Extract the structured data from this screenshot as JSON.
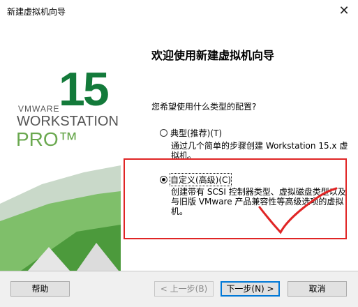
{
  "window": {
    "title": "新建虚拟机向导"
  },
  "branding": {
    "version": "15",
    "vmware": "VMWARE",
    "workstation": "WORKSTATION",
    "pro": "PRO™"
  },
  "content": {
    "heading": "欢迎使用新建虚拟机向导",
    "question": "您希望使用什么类型的配置?",
    "options": [
      {
        "label": "典型(推荐)(T)",
        "selected": false,
        "desc": "通过几个简单的步骤创建 Workstation 15.x 虚拟机。"
      },
      {
        "label": "自定义(高级)(C)",
        "selected": true,
        "desc": "创建带有 SCSI 控制器类型、虚拟磁盘类型以及与旧版 VMware 产品兼容性等高级选项的虚拟机。"
      }
    ]
  },
  "buttons": {
    "help": "帮助",
    "back": "< 上一步(B)",
    "next": "下一步(N) >",
    "cancel": "取消"
  },
  "colors": {
    "accent": "#0078d7",
    "annotation": "#e02525",
    "brand_green": "#137a3a"
  }
}
